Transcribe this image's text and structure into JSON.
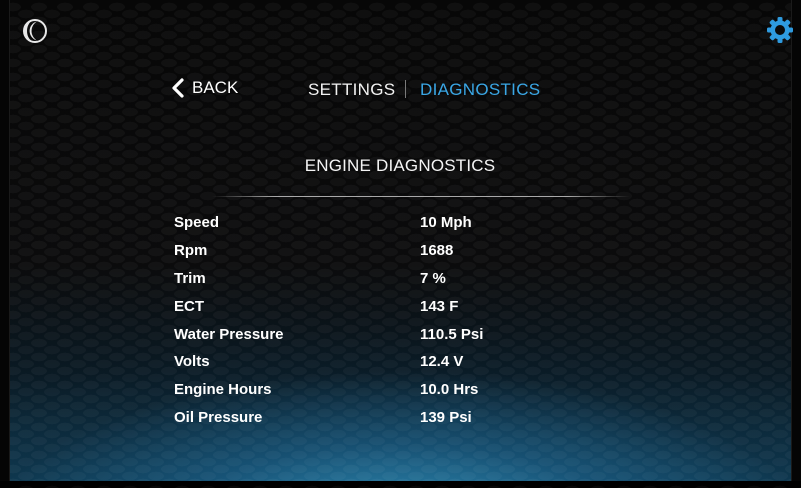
{
  "header": {
    "theme_icon": "moon-icon",
    "settings_icon": "gear-icon"
  },
  "nav": {
    "back_label": "BACK",
    "tabs": [
      {
        "label": "SETTINGS",
        "active": false
      },
      {
        "label": "DIAGNOSTICS",
        "active": true
      }
    ]
  },
  "section": {
    "title": "ENGINE DIAGNOSTICS"
  },
  "diagnostics": [
    {
      "label": "Speed",
      "value": "10 Mph"
    },
    {
      "label": "Rpm",
      "value": "1688"
    },
    {
      "label": "Trim",
      "value": "7 %"
    },
    {
      "label": "ECT",
      "value": "143 F"
    },
    {
      "label": "Water Pressure",
      "value": "110.5 Psi"
    },
    {
      "label": "Volts",
      "value": "12.4 V"
    },
    {
      "label": "Engine Hours",
      "value": "10.0 Hrs"
    },
    {
      "label": "Oil Pressure",
      "value": "139 Psi"
    }
  ],
  "colors": {
    "accent": "#3aa7e6",
    "text": "#ffffff",
    "gear": "#2e9be0"
  }
}
